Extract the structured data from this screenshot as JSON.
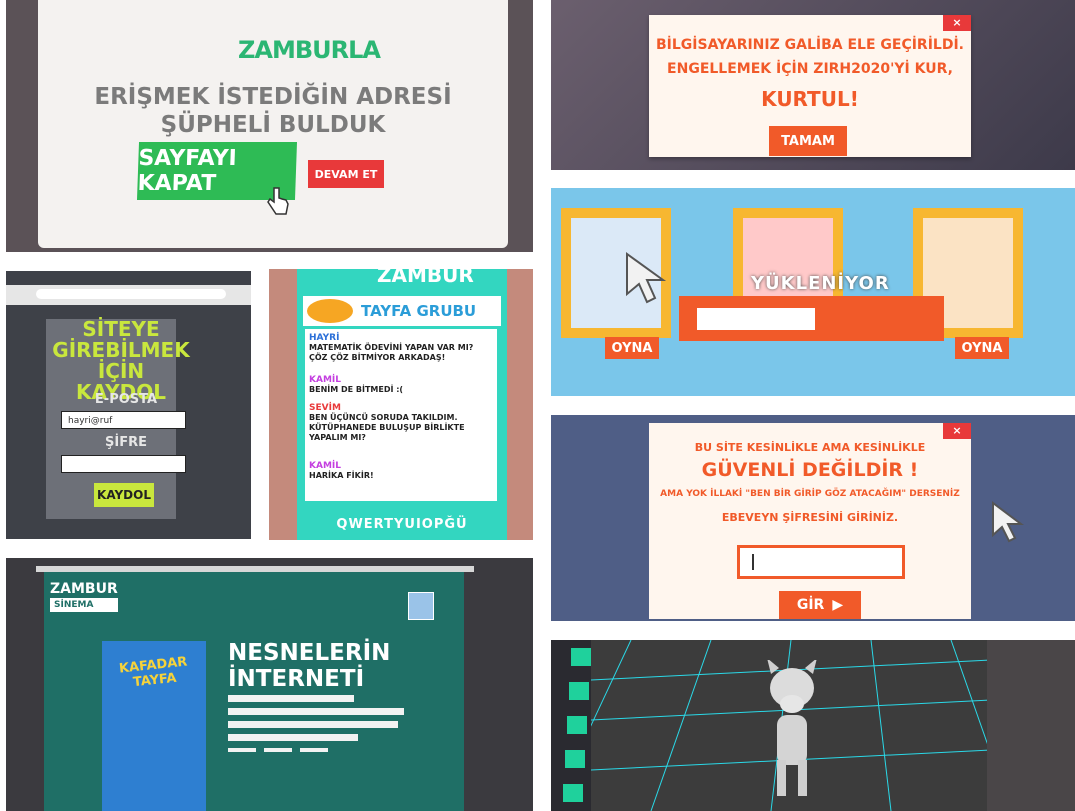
{
  "panel1": {
    "logo": "ZAMBURLA",
    "heading_line1": "ERİŞMEK İSTEDİĞİN ADRESİ",
    "heading_line2": "ŞÜPHELİ BULDUK",
    "close_button": "SAYFAYI KAPAT",
    "continue_button": "DEVAM ET"
  },
  "panel2": {
    "close": "×",
    "line1": "BİLGİSAYARINIZ GALİBA ELE GEÇİRİLDİ.",
    "line2": "ENGELLEMEK İÇİN ZIRH2020'Yİ KUR,",
    "line3": "KURTUL!",
    "ok_button": "TAMAM"
  },
  "panel3": {
    "title_line1": "SİTEYE",
    "title_line2": "GİREBİLMEK İÇİN",
    "title_line3": "KAYDOL",
    "email_label": "E-POSTA",
    "email_value": "hayri@ruf",
    "password_label": "ŞİFRE",
    "password_value": "",
    "register_button": "KAYDOL"
  },
  "panel4": {
    "brand": "ZAMBUR",
    "group_title": "TAYFA GRUBU",
    "messages": [
      {
        "name": "HAYRİ",
        "text": "MATEMATİK ÖDEVİNİ YAPAN VAR MI? ÇÖZ ÇÖZ BİTMİYOR ARKADAŞ!",
        "color": "#2b6fd8"
      },
      {
        "name": "KAMİL",
        "text": "BENİM DE BİTMEDİ :(",
        "color": "#c43fe0"
      },
      {
        "name": "SEVİM",
        "text": "BEN ÜÇÜNCÜ SORUDA TAKILDIM. KÜTÜPHANEDE BULUŞUP BİRLİKTE YAPALIM MI?",
        "color": "#e8393a"
      },
      {
        "name": "KAMİL",
        "text": "HARİKA FİKİR!",
        "color": "#c43fe0"
      }
    ],
    "keyboard_row": "QWERTYUIOPĞÜ"
  },
  "panel5": {
    "loading": "YÜKLENİYOR",
    "play_left": "OYNA",
    "play_right": "OYNA"
  },
  "panel6": {
    "close": "×",
    "line1": "BU SİTE KESİNLİKLE AMA KESİNLİKLE",
    "line2": "GÜVENLİ DEĞİLDİR !",
    "line3": "AMA YOK İLLAKİ \"BEN BİR GİRİP GÖZ ATACAĞIM\" DERSENİZ",
    "line4": "EBEVEYN ŞİFRESİNİ GİRİNİZ.",
    "password_value": "",
    "submit_button": "GİR",
    "submit_arrow": "▶"
  },
  "panel7": {
    "brand": "ZAMBUR",
    "brand_sub": "SİNEMA",
    "poster_title": "KAFADAR TAYFA",
    "title_line1": "NESNELERİN",
    "title_line2": "İNTERNETİ"
  },
  "colors": {
    "green": "#2ebb55",
    "red": "#e8393a",
    "orange": "#f15a29",
    "teal": "#33d6c0",
    "lime": "#c9e73d"
  }
}
